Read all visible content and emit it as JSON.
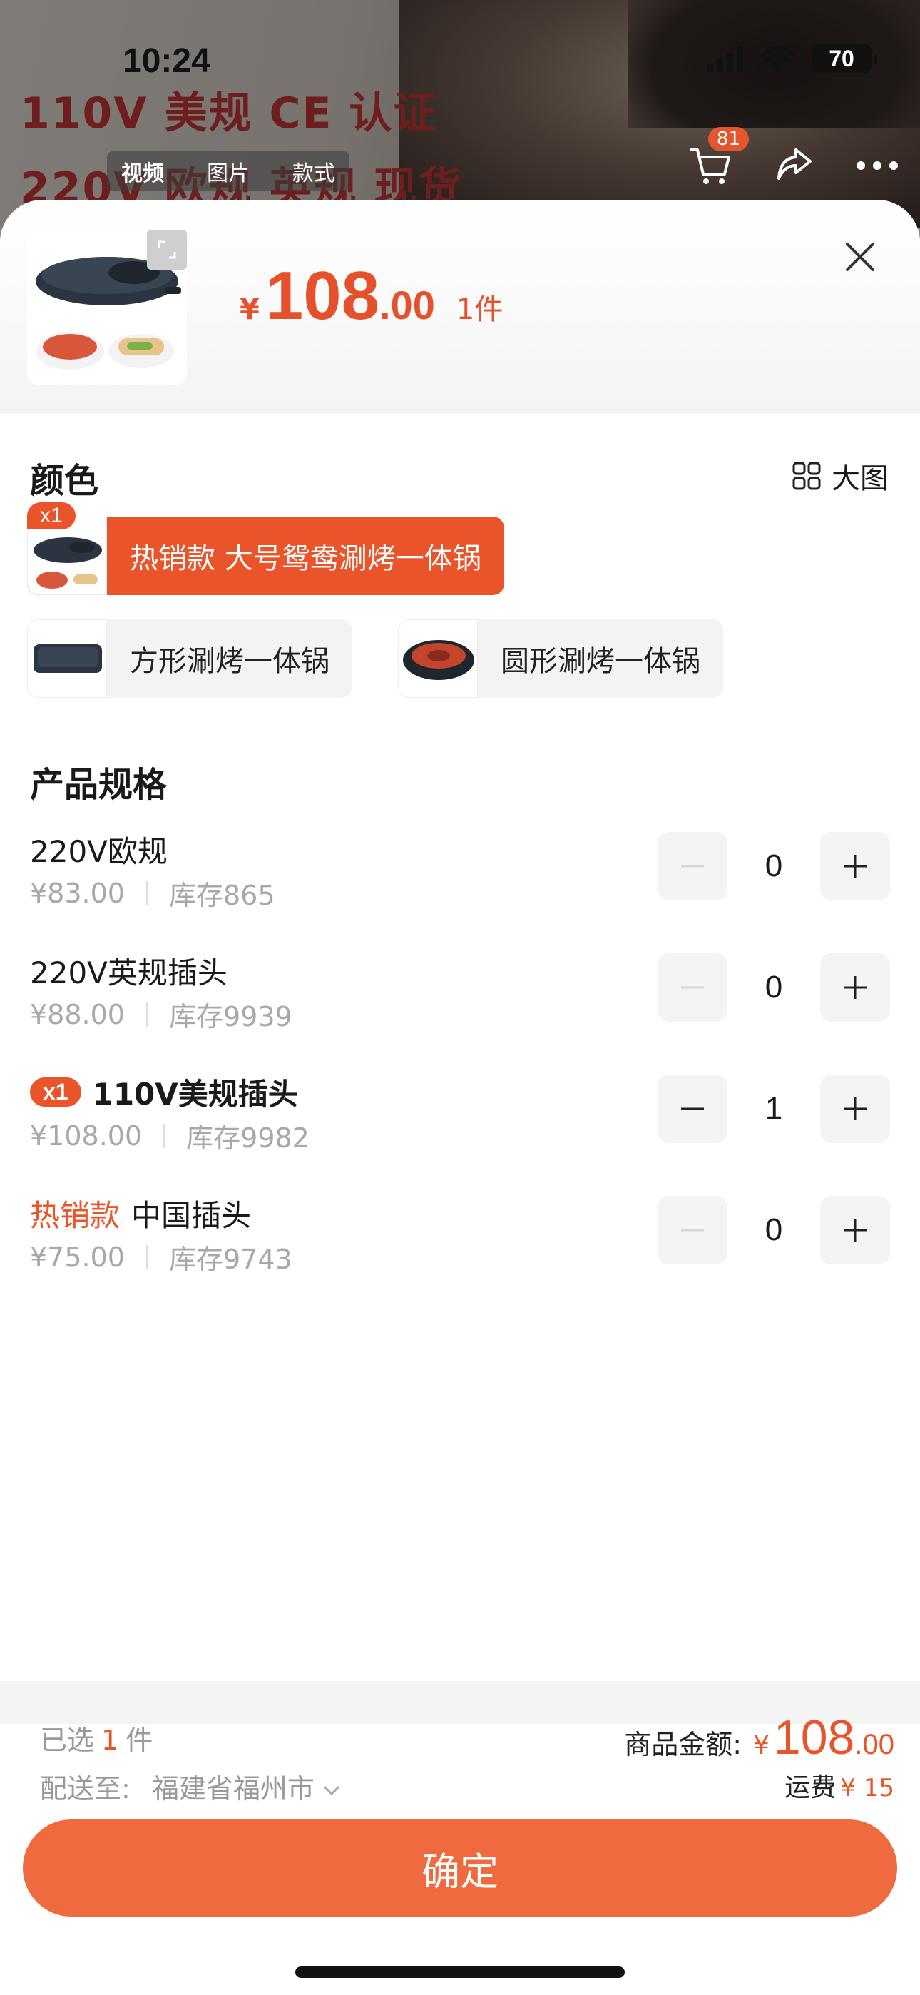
{
  "status_bar": {
    "time": "10:24",
    "battery": "70"
  },
  "background": {
    "headline_line1": "110V 美规 CE 认证",
    "headline_line2": "220V 欧规 英规 现货",
    "media_tabs": [
      "视频",
      "图片",
      "款式"
    ],
    "cart_count": "81"
  },
  "header": {
    "currency": "¥",
    "price_int": "108",
    "price_dec": ".00",
    "quantity": "1件"
  },
  "color_section": {
    "title": "颜色",
    "big_image_label": "大图",
    "options": [
      {
        "label": "热销款 大号鸳鸯涮烤一体锅",
        "selected": true,
        "badge": "x1"
      },
      {
        "label": "方形涮烤一体锅",
        "selected": false
      },
      {
        "label": "圆形涮烤一体锅",
        "selected": false
      }
    ]
  },
  "spec_section": {
    "title": "产品规格",
    "items": [
      {
        "name": "220V欧规",
        "price": "¥83.00",
        "stock": "库存865",
        "qty": "0"
      },
      {
        "name": "220V英规插头",
        "price": "¥88.00",
        "stock": "库存9939",
        "qty": "0"
      },
      {
        "badge": "x1",
        "name": "110V美规插头",
        "price": "¥108.00",
        "stock": "库存9982",
        "qty": "1"
      },
      {
        "tag": "热销款",
        "name": "中国插头",
        "price": "¥75.00",
        "stock": "库存9743",
        "qty": "0"
      }
    ]
  },
  "footer": {
    "selected_prefix": "已选",
    "selected_count": "1",
    "selected_suffix": "件",
    "ship_to_label": "配送至:",
    "ship_to_value": "福建省福州市",
    "amount_label": "商品金额:",
    "amount_currency": "¥",
    "amount_int": "108",
    "amount_dec": ".00",
    "shipping_label": "运费",
    "shipping_value": "¥ 15",
    "confirm_label": "确定"
  },
  "colors": {
    "accent": "#e9542b",
    "button": "#ef6a3e"
  }
}
